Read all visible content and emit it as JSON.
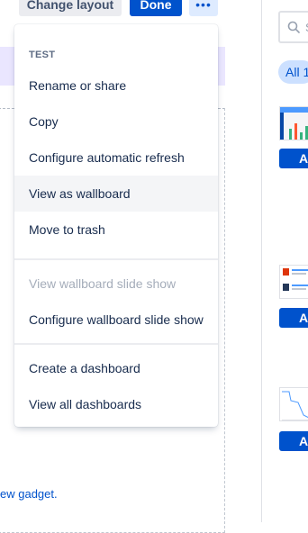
{
  "toolbar": {
    "change_layout_label": "Change layout",
    "done_label": "Done",
    "more_label": "•••"
  },
  "background": {
    "add_gadget_link": "ew gadget."
  },
  "right_panel": {
    "search_placeholder": "S",
    "filter_all_label": "All 1",
    "add_labels": [
      "A",
      "A",
      "A"
    ]
  },
  "menu": {
    "heading": "TEST",
    "items": [
      {
        "label": "Rename or share",
        "state": "normal"
      },
      {
        "label": "Copy",
        "state": "normal"
      },
      {
        "label": "Configure automatic refresh",
        "state": "normal"
      },
      {
        "label": "View as wallboard",
        "state": "hover"
      },
      {
        "label": "Move to trash",
        "state": "normal"
      },
      {
        "label": "View wallboard slide show",
        "state": "disabled"
      },
      {
        "label": "Configure wallboard slide show",
        "state": "normal"
      },
      {
        "label": "Create a dashboard",
        "state": "normal"
      },
      {
        "label": "View all dashboards",
        "state": "normal"
      }
    ]
  },
  "colors": {
    "primary": "#0052cc",
    "hover_bg": "#f4f5f7",
    "disabled_text": "#a5adba",
    "purple_band": "#eae6ff"
  }
}
